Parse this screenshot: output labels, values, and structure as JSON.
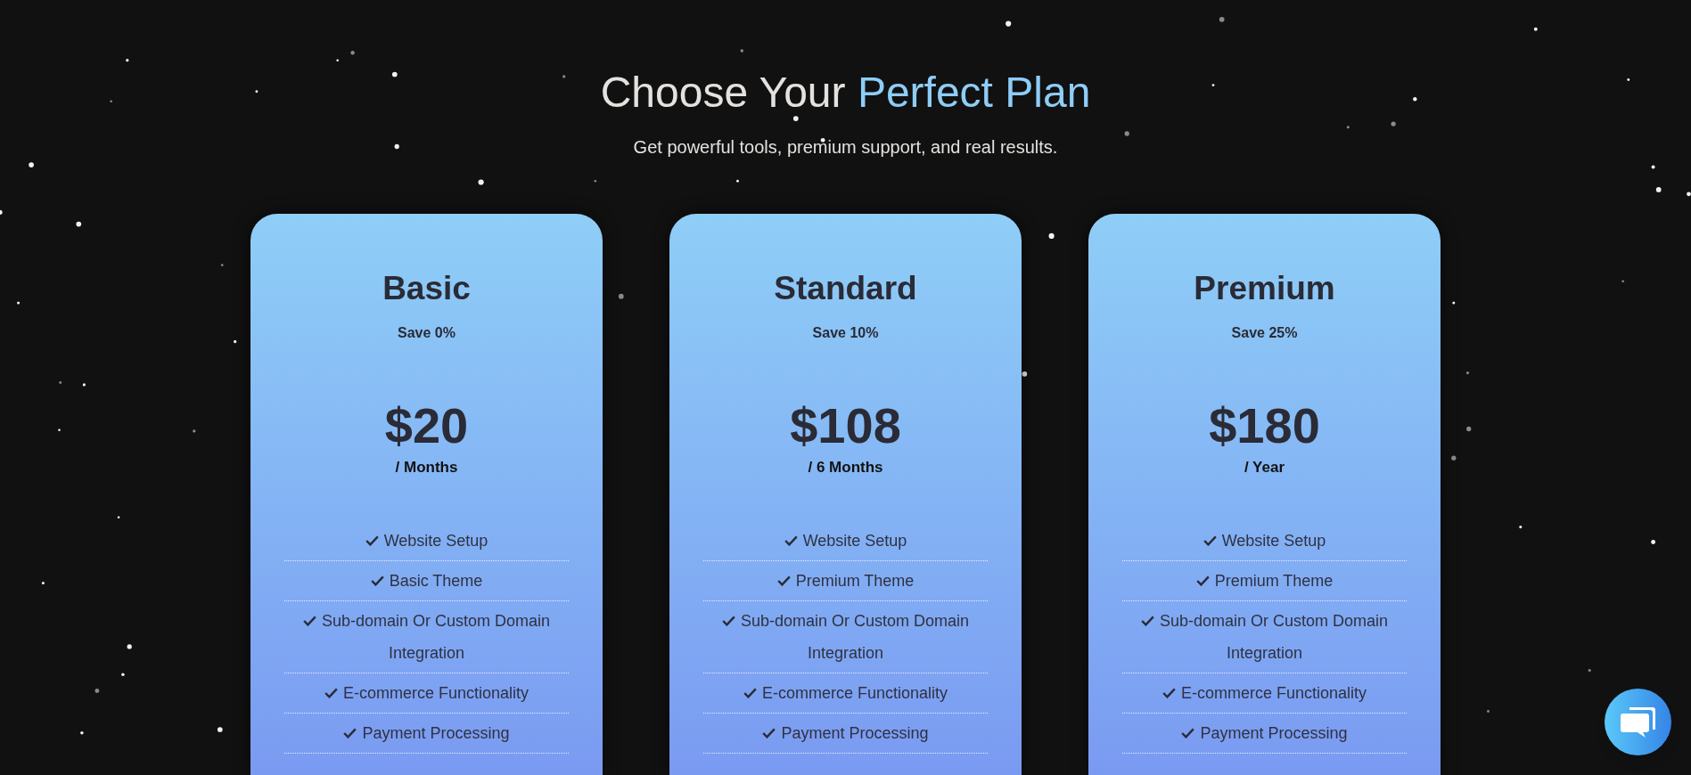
{
  "header": {
    "title": "Choose Your",
    "title_highlight": "Perfect Plan",
    "subtitle": "Get powerful tools, premium support, and real results."
  },
  "plans": [
    {
      "name": "Basic",
      "savings": "Save 0%",
      "price": "$20",
      "period": "/ Months",
      "features": [
        "Website Setup",
        "Basic Theme",
        "Sub-domain Or Custom Domain Integration",
        "E-commerce Functionality",
        "Payment Processing"
      ]
    },
    {
      "name": "Standard",
      "savings": "Save 10%",
      "price": "$108",
      "period": "/ 6 Months",
      "features": [
        "Website Setup",
        "Premium Theme",
        "Sub-domain Or Custom Domain Integration",
        "E-commerce Functionality",
        "Payment Processing"
      ]
    },
    {
      "name": "Premium",
      "savings": "Save 25%",
      "price": "$180",
      "period": "/ Year",
      "features": [
        "Website Setup",
        "Premium Theme",
        "Sub-domain Or Custom Domain Integration",
        "E-commerce Functionality",
        "Payment Processing"
      ]
    }
  ]
}
